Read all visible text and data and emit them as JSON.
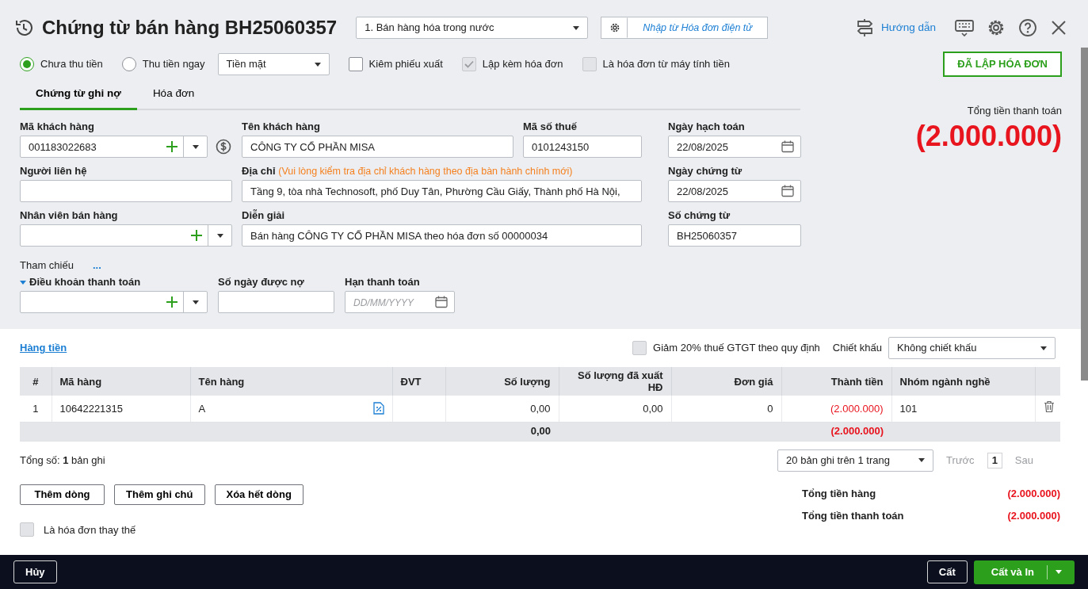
{
  "header": {
    "title": "Chứng từ bán hàng BH25060357",
    "voucher_type": "1. Bán hàng hóa trong nước",
    "import_button": "Nhập từ Hóa đơn điện tử",
    "help_link": "Hướng dẫn"
  },
  "payment_options": [
    {
      "label": "Chưa thu tiền",
      "selected": true
    },
    {
      "label": "Thu tiền ngay",
      "selected": false
    }
  ],
  "payment_method": "Tiền mặt",
  "options": [
    {
      "label": "Kiêm phiếu xuất",
      "checked": false,
      "disabled": false
    },
    {
      "label": "Lập kèm hóa đơn",
      "checked": true,
      "disabled": true
    },
    {
      "label": "Là hóa đơn từ máy tính tiền",
      "checked": false,
      "disabled": true
    }
  ],
  "status_badge": "ĐÃ LẬP HÓA ĐƠN",
  "tabs": [
    {
      "label": "Chứng từ ghi nợ",
      "selected": true
    },
    {
      "label": "Hóa đơn",
      "selected": false
    }
  ],
  "grand_total": {
    "label": "Tổng tiền thanh toán",
    "amount": "(2.000.000)"
  },
  "form": {
    "customer_code": {
      "label": "Mã khách hàng",
      "value": "001183022683"
    },
    "customer_name": {
      "label": "Tên khách hàng",
      "value": "CÔNG TY CỔ PHẦN MISA"
    },
    "tax_code": {
      "label": "Mã số thuế",
      "value": "0101243150"
    },
    "posting_date": {
      "label": "Ngày hạch toán",
      "value": "22/08/2025"
    },
    "contact": {
      "label": "Người liên hệ"
    },
    "address": {
      "label": "Địa chỉ",
      "note": "(Vui lòng kiểm tra địa chỉ khách hàng theo địa bàn hành chính mới)",
      "value": "Tầng 9, tòa nhà Technosoft, phố Duy Tân, Phường Cầu Giấy, Thành phố Hà Nội,"
    },
    "document_date": {
      "label": "Ngày chứng từ",
      "value": "22/08/2025"
    },
    "salesperson": {
      "label": "Nhân viên bán hàng"
    },
    "description": {
      "label": "Diễn giải",
      "value": "Bán hàng CÔNG TY CỔ PHẦN MISA theo hóa đơn số 00000034"
    },
    "document_no": {
      "label": "Số chứng từ",
      "value": "BH25060357"
    },
    "reference": {
      "label": "Tham chiếu",
      "link": "..."
    },
    "payment_terms": {
      "label": "Điều khoản thanh toán",
      "expanded": true
    },
    "credit_days": {
      "label": "Số ngày được nợ"
    },
    "due_date": {
      "label": "Hạn thanh toán",
      "placeholder": "DD/MM/YYYY"
    }
  },
  "detail": {
    "section_link": "Hàng tiền",
    "vat_reduction": {
      "label": "Giảm 20% thuế GTGT theo quy định",
      "checked": false
    },
    "discount": {
      "label": "Chiết khấu",
      "value": "Không chiết khấu"
    }
  },
  "table": {
    "columns": [
      {
        "label": "#",
        "kind": "index"
      },
      {
        "label": "Mã hàng",
        "kind": "text"
      },
      {
        "label": "Tên hàng",
        "kind": "name"
      },
      {
        "label": "ĐVT",
        "kind": "text"
      },
      {
        "label": "Số lượng",
        "kind": "number"
      },
      {
        "label": "Số lượng đã xuất HĐ",
        "kind": "number"
      },
      {
        "label": "Đơn giá",
        "kind": "number"
      },
      {
        "label": "Thành tiền",
        "kind": "amount"
      },
      {
        "label": "Nhóm ngành nghề",
        "kind": "text"
      }
    ],
    "rows": [
      {
        "cells": [
          "1",
          "10642221315",
          "A",
          null,
          "0,00",
          "0,00",
          "0",
          "(2.000.000)",
          "101"
        ],
        "negative": true
      }
    ],
    "totals_row": {
      "cells": [
        null,
        null,
        null,
        null,
        "0,00",
        null,
        null,
        "(2.000.000)",
        null
      ],
      "negative": true
    }
  },
  "pager": {
    "total_label": "Tổng số:",
    "total_count": "1",
    "total_unit": "bản ghi",
    "page_size": "20 bản ghi trên 1 trang",
    "prev": "Trước",
    "page": "1",
    "next": "Sau"
  },
  "row_buttons": [
    "Thêm dòng",
    "Thêm ghi chú",
    "Xóa hết dòng"
  ],
  "summary": [
    {
      "label": "Tổng tiền hàng",
      "value": "(2.000.000)",
      "negative": true
    },
    {
      "label": "Tổng tiền thanh toán",
      "value": "(2.000.000)",
      "negative": true
    }
  ],
  "replacement_invoice": {
    "label": "Là hóa đơn thay thế",
    "checked": false
  },
  "footer": {
    "cancel": "Hủy",
    "save": "Cất",
    "save_print": "Cất và In"
  }
}
